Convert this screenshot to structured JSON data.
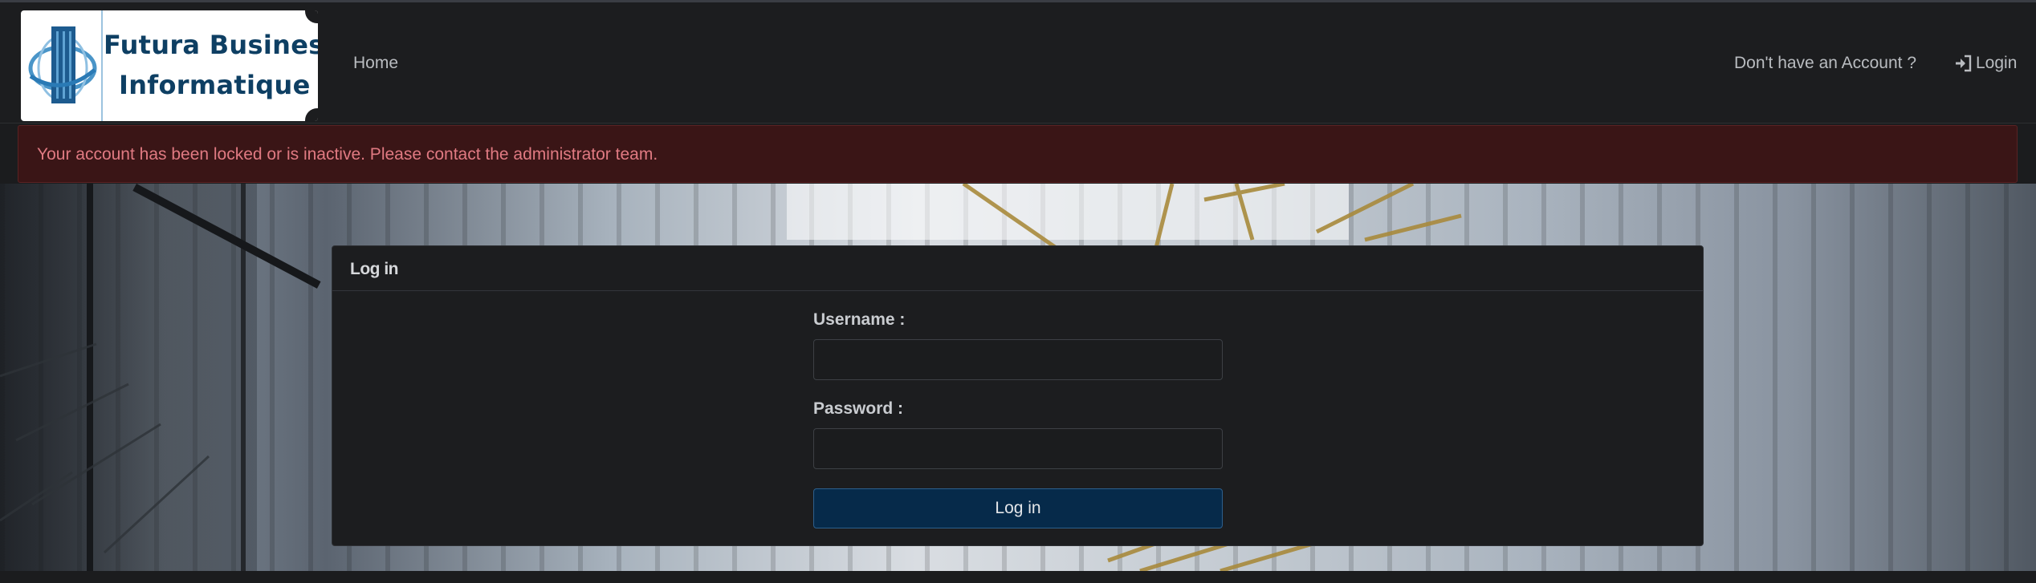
{
  "brand": {
    "line1": "Futura Business",
    "line2": "Informatique",
    "color": "#0e3f63"
  },
  "nav": {
    "home": "Home",
    "signup": "Don't have an Account ?",
    "login": "Login"
  },
  "alert": {
    "message": "Your account has been locked or is inactive. Please contact the administrator team.",
    "color": "#e07a82"
  },
  "login_form": {
    "title": "Log in",
    "username_label": "Username :",
    "username_value": "",
    "password_label": "Password :",
    "password_value": "",
    "submit_label": "Log in",
    "submit_color": "#062a4a"
  },
  "icons": {
    "login_icon": "sign-in-icon",
    "logo_icon": "building-globe-icon"
  }
}
